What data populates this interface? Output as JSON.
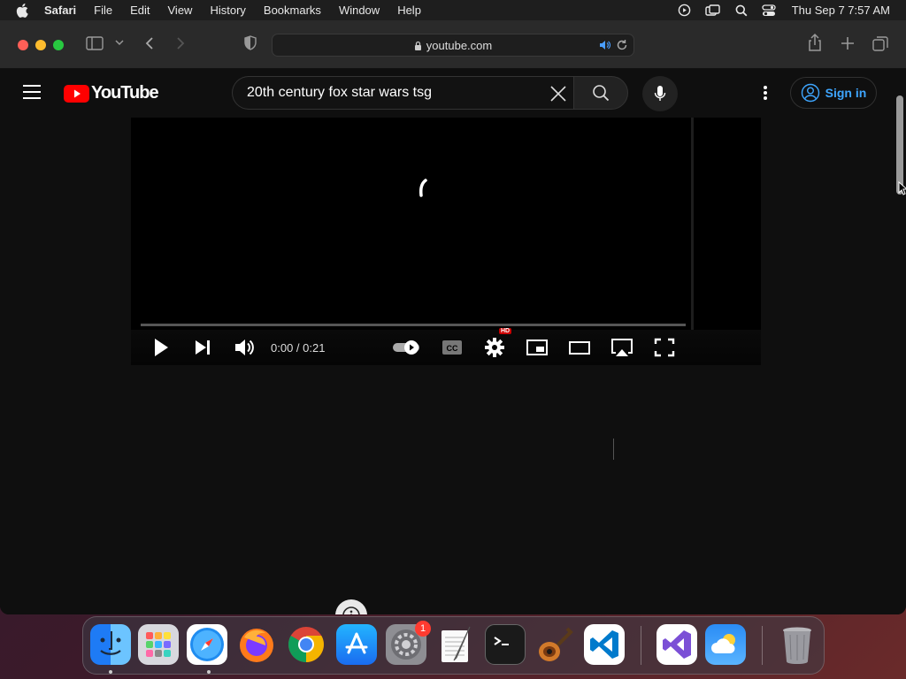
{
  "menubar": {
    "items": [
      "Safari",
      "File",
      "Edit",
      "View",
      "History",
      "Bookmarks",
      "Window",
      "Help"
    ],
    "clock": "Thu Sep 7  7:57 AM"
  },
  "browser": {
    "address": "youtube.com"
  },
  "youtube": {
    "search_value": "20th century fox star wars tsg",
    "signin_label": "Sign in",
    "brand_color": "#ff0000",
    "link_color": "#3ea6ff"
  },
  "player": {
    "time_display": "0:00 / 0:21",
    "progress": 0.0,
    "hd_badge": "HD",
    "autoplay": true
  },
  "dock": {
    "apps": [
      "Finder",
      "Launchpad",
      "Safari",
      "Firefox",
      "Chrome",
      "App Store",
      "System Settings",
      "TextEdit",
      "Terminal",
      "GarageBand",
      "Visual Studio Code",
      "Visual Studio",
      "Weather",
      "Trash"
    ],
    "system_settings_badge": "1"
  }
}
